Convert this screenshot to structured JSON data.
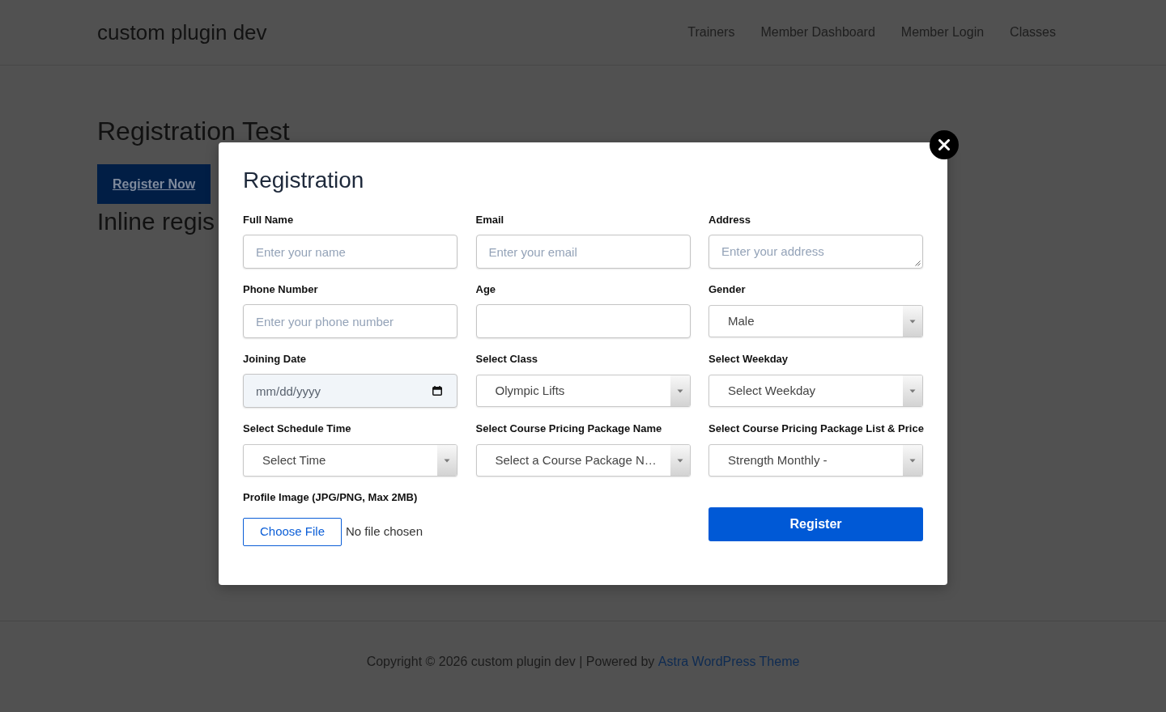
{
  "site": {
    "title": "custom plugin dev",
    "nav": [
      "Trainers",
      "Member Dashboard",
      "Member Login",
      "Classes"
    ]
  },
  "page": {
    "heading": "Registration Test",
    "button": "Register Now",
    "subheading": "Inline regis"
  },
  "modal": {
    "title": "Registration",
    "fields": [
      {
        "kind": "text",
        "label": "Full Name",
        "placeholder": "Enter your name"
      },
      {
        "kind": "text",
        "label": "Email",
        "placeholder": "Enter your email"
      },
      {
        "kind": "textarea",
        "label": "Address",
        "placeholder": "Enter your address"
      },
      {
        "kind": "text",
        "label": "Phone Number",
        "placeholder": "Enter your phone number"
      },
      {
        "kind": "text",
        "label": "Age"
      },
      {
        "kind": "select",
        "label": "Gender",
        "value": "Male"
      },
      {
        "kind": "date",
        "label": "Joining Date",
        "placeholder": "mm/dd/yyyy"
      },
      {
        "kind": "select",
        "label": "Select Class",
        "value": "Olympic Lifts"
      },
      {
        "kind": "select",
        "label": "Select Weekday",
        "value": "Select Weekday"
      },
      {
        "kind": "select",
        "label": "Select Schedule Time",
        "value": "Select Time"
      },
      {
        "kind": "select",
        "label": "Select Course Pricing Package Name",
        "value": "Select a Course Package N…"
      },
      {
        "kind": "select",
        "label": "Select Course Pricing Package List & Price",
        "value": "Strength Monthly -"
      }
    ],
    "file": {
      "label": "Profile Image (JPG/PNG, Max 2MB)",
      "button": "Choose File",
      "status": "No file chosen"
    },
    "submit": "Register"
  },
  "footer": {
    "text": "Copyright © 2026 custom plugin dev | Powered by",
    "link": "Astra WordPress Theme"
  }
}
